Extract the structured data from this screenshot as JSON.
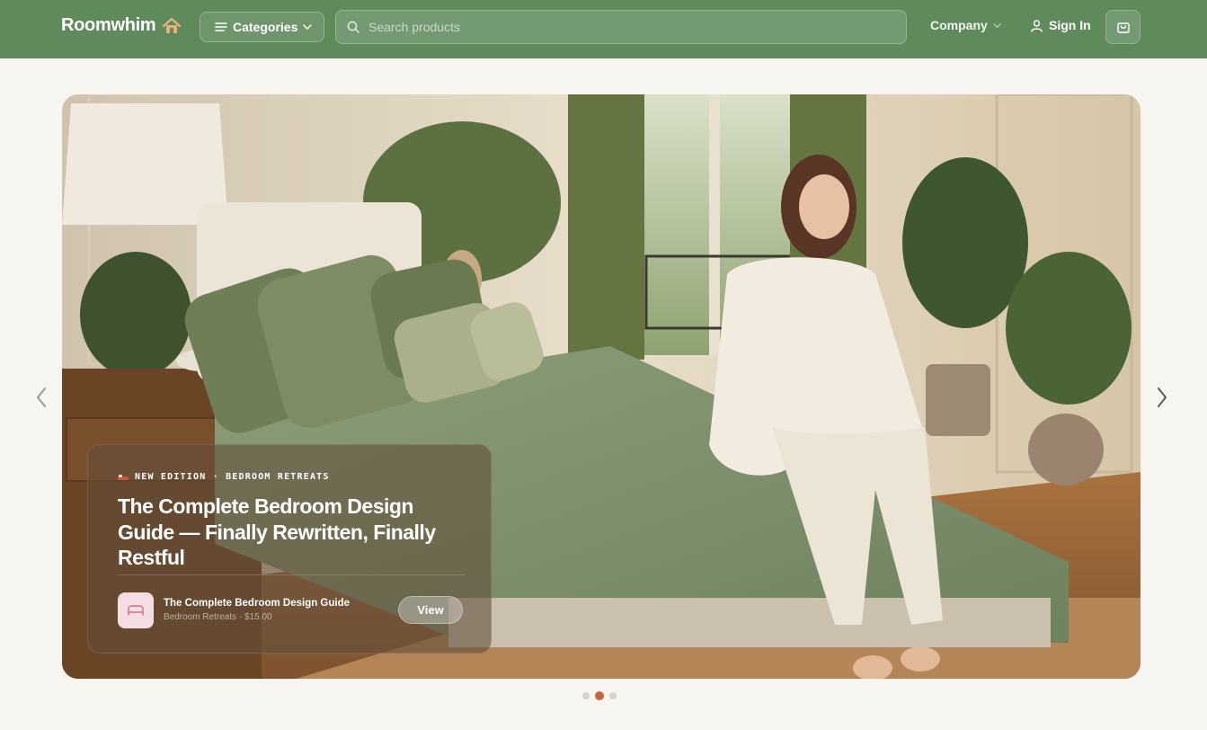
{
  "nav": {
    "brand": "Roomwhim",
    "categories_label": "Categories",
    "search_placeholder": "Search products",
    "company_label": "Company",
    "signin_label": "Sign In"
  },
  "hero": {
    "kicker": "NEW EDITION · BEDROOM RETREATS",
    "headline": "The Complete Bedroom Design Guide — Finally Rewritten, Finally Restful",
    "product": {
      "title": "The Complete Bedroom Design Guide",
      "subtitle": "Bedroom Retreats · $15.00"
    },
    "view_label": "View"
  },
  "carousel": {
    "slide_count": 3,
    "active_index": 1
  },
  "colors": {
    "nav_bg": "#5e8a5c",
    "page_bg": "#f7f5f0",
    "active_dot": "#c4673f",
    "thumb_bg": "#f4dde3"
  }
}
